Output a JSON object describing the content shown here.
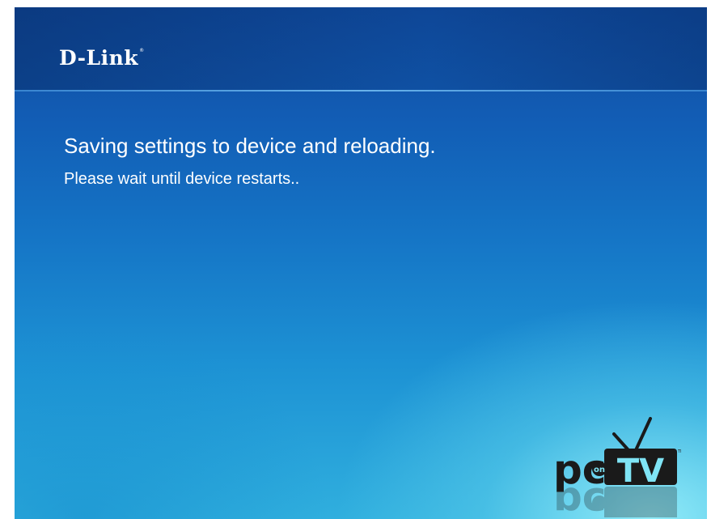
{
  "brand": {
    "logo_text": "D-Link",
    "registered_mark": "®"
  },
  "message": {
    "headline": "Saving settings to device and reloading.",
    "detail": "Please wait until device restarts.."
  },
  "pctv_logo": {
    "pc_text": "pc",
    "on_text": "on",
    "tv_text": "TV",
    "trademark": "TM"
  },
  "colors": {
    "background_top": "#0f4a9e",
    "background_bottom": "#30afde",
    "text": "#ffffff",
    "logo_dark": "#1a1a1a"
  }
}
